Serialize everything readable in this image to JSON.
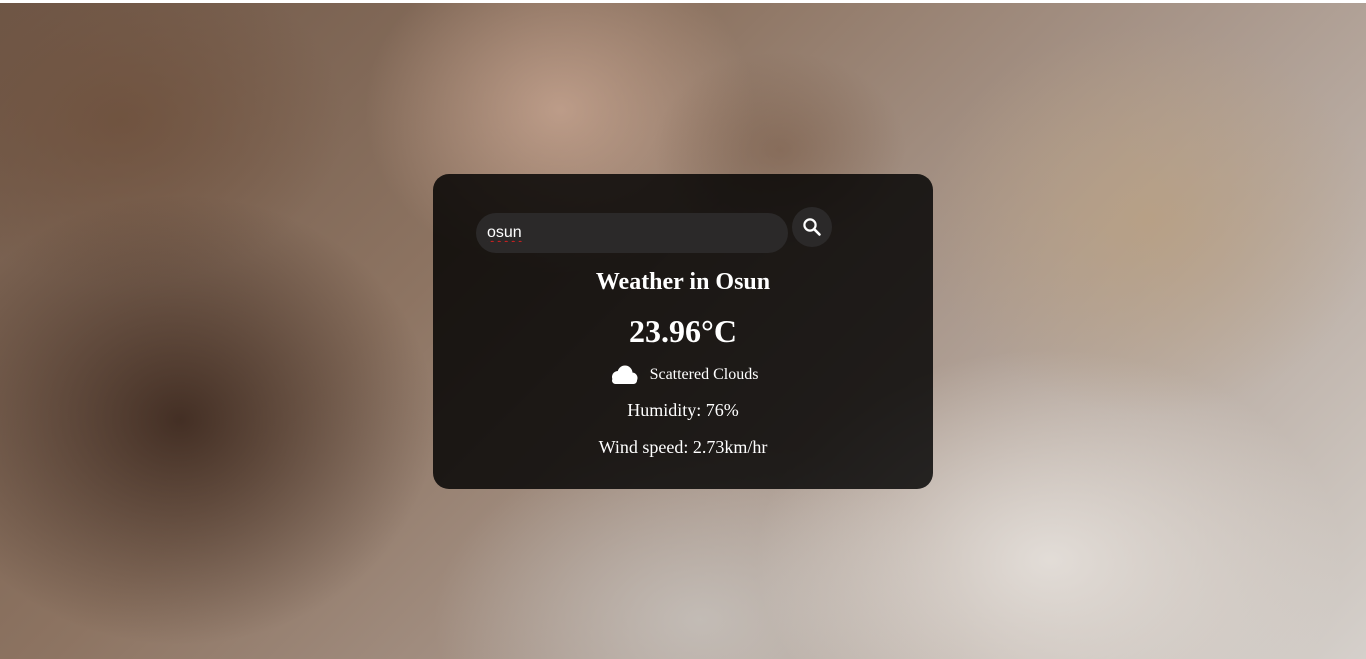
{
  "search": {
    "value": "osun",
    "placeholder": ""
  },
  "weather": {
    "city_title": "Weather in Osun",
    "temperature": "23.96°C",
    "description": "Scattered Clouds",
    "icon": "cloud-icon",
    "humidity": "Humidity: 76%",
    "wind": "Wind speed: 2.73km/hr"
  },
  "colors": {
    "card_background": "#000000",
    "input_background": "#2b2929",
    "text": "#ffffff"
  }
}
